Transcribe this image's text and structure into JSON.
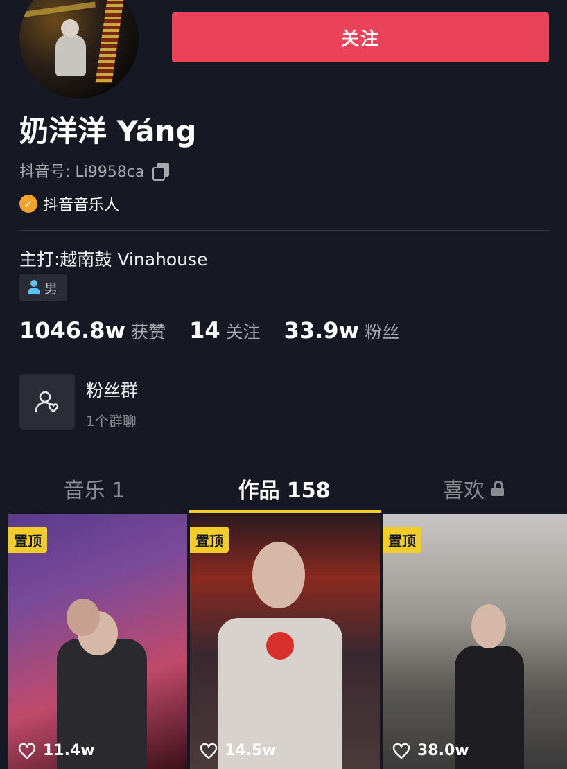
{
  "header": {
    "follow_label": "关注",
    "name": "奶洋洋 Yáng",
    "douyin_id": "抖音号: Li9958ca",
    "verified_label": "抖音音乐人",
    "genre": "主打:越南鼓 Vinahouse",
    "gender": "男"
  },
  "stats": [
    {
      "value": "1046.8w",
      "label": "获赞"
    },
    {
      "value": "14",
      "label": "关注"
    },
    {
      "value": "33.9w",
      "label": "粉丝"
    }
  ],
  "fan_group": {
    "title": "粉丝群",
    "subtitle": "1个群聊"
  },
  "tabs": {
    "music": "音乐 1",
    "works": "作品 158",
    "likes": "喜欢"
  },
  "videos": [
    {
      "badge": "置顶",
      "likes": "11.4w"
    },
    {
      "badge": "置顶",
      "likes": "14.5w"
    },
    {
      "badge": "置顶",
      "likes": "38.0w"
    }
  ],
  "colors": {
    "background": "#161823",
    "follow_button": "#ea4258",
    "accent_yellow": "#f2cc2b",
    "verified_orange": "#f4a32a"
  }
}
